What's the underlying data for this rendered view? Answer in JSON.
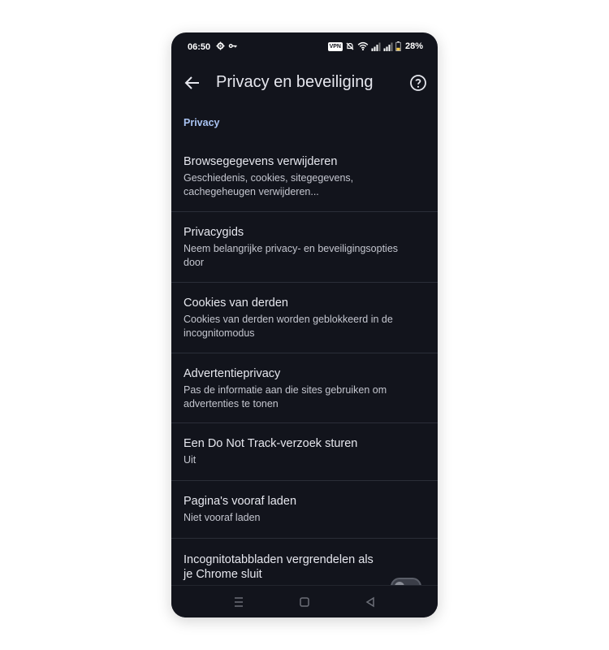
{
  "status_bar": {
    "time": "06:50",
    "vpn_label": "VPN",
    "battery": "28%"
  },
  "app_bar": {
    "title": "Privacy en beveiliging",
    "back_icon": "arrow-left-icon",
    "help_icon": "help-circle-icon"
  },
  "section": {
    "header": "Privacy"
  },
  "items": [
    {
      "title": "Browsegegevens verwijderen",
      "subtitle": "Geschiedenis, cookies, sitegegevens, cachegeheugen verwijderen..."
    },
    {
      "title": "Privacygids",
      "subtitle": "Neem belangrijke privacy- en beveiligingsopties door"
    },
    {
      "title": "Cookies van derden",
      "subtitle": "Cookies van derden worden geblokkeerd in de incognitomodus"
    },
    {
      "title": "Advertentieprivacy",
      "subtitle": "Pas de informatie aan die sites gebruiken om advertenties te tonen"
    },
    {
      "title": "Een Do Not Track-verzoek sturen",
      "subtitle": "Uit"
    },
    {
      "title": "Pagina's vooraf laden",
      "subtitle": "Niet vooraf laden"
    },
    {
      "title": "Incognitotabbladen vergrendelen als je Chrome sluit",
      "toggle_on": false
    }
  ],
  "colors": {
    "background": "#12141c",
    "section_accent": "#a9c3f2",
    "text_primary": "#e6e7ee",
    "text_secondary": "#c4c6cf",
    "divider": "#2b2e38"
  }
}
